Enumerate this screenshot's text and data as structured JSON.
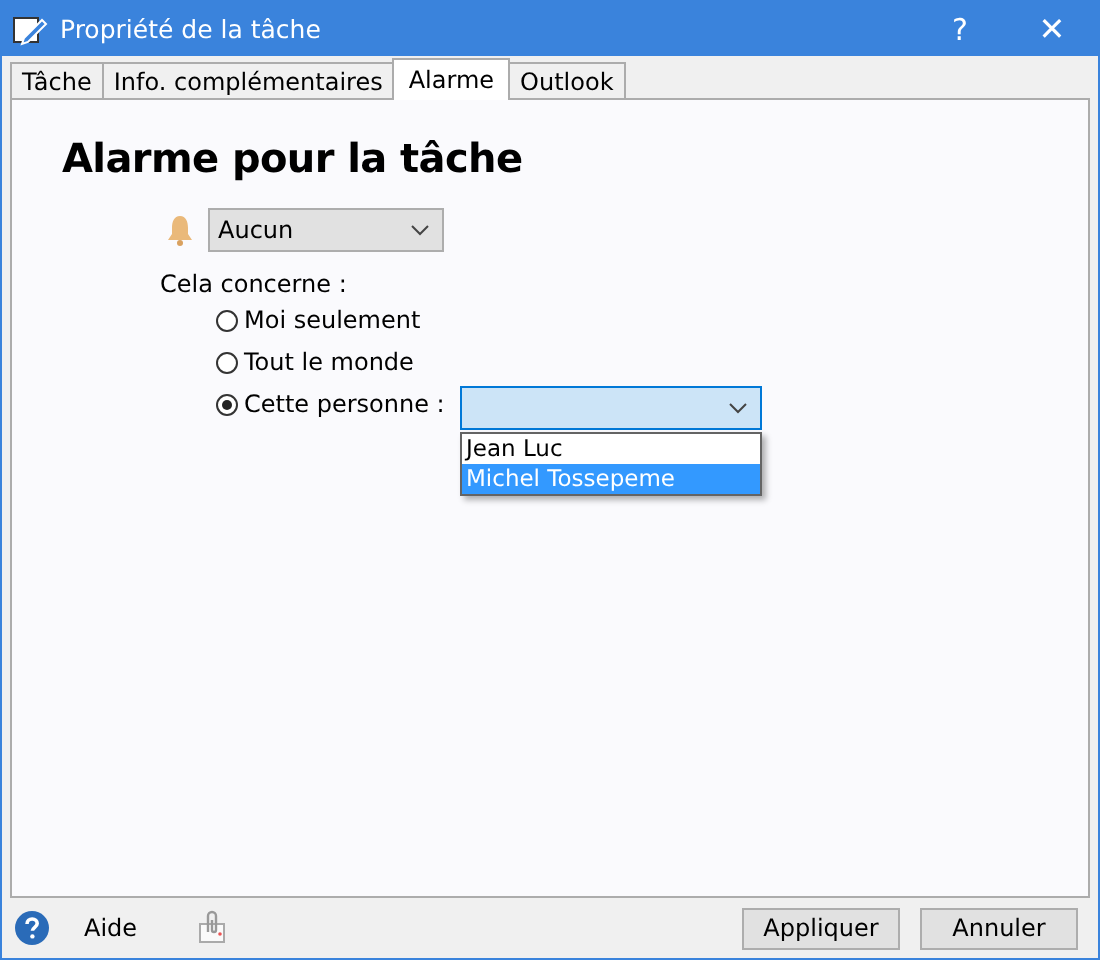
{
  "window": {
    "title": "Propriété de la tâche",
    "help": "?",
    "close": "✕"
  },
  "tabs": [
    {
      "label": "Tâche",
      "selected": false
    },
    {
      "label": "Info. complémentaires",
      "selected": false
    },
    {
      "label": "Alarme",
      "selected": true
    },
    {
      "label": "Outlook",
      "selected": false
    }
  ],
  "heading": "Alarme pour la tâche",
  "alarm_select": {
    "value": "Aucun"
  },
  "concern_label": "Cela concerne :",
  "options": [
    {
      "label": "Moi seulement",
      "selected": false
    },
    {
      "label": "Tout le monde",
      "selected": false
    },
    {
      "label": "Cette personne :",
      "selected": true
    }
  ],
  "person_dropdown": {
    "expanded": true,
    "items": [
      {
        "label": "Jean Luc",
        "selected": false
      },
      {
        "label": "Michel Tossepeme",
        "selected": true
      }
    ]
  },
  "footer": {
    "help_label": "Aide",
    "buttons": [
      "Appliquer",
      "Annuler"
    ]
  }
}
